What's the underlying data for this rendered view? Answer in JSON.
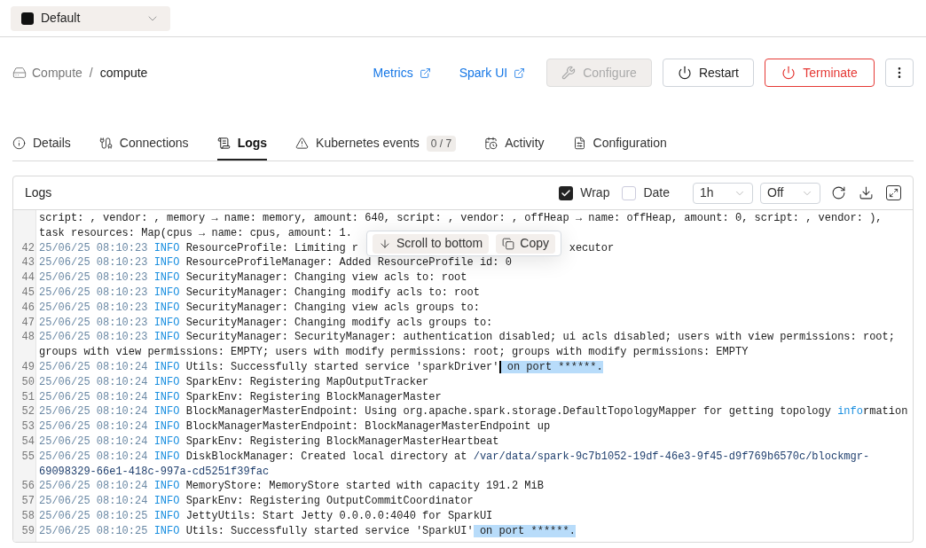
{
  "environment": {
    "label": "Default",
    "color": "#111111"
  },
  "breadcrumb_separator": "/",
  "breadcrumb": [
    {
      "label": "Compute",
      "kind": "parent"
    },
    {
      "label": "compute",
      "kind": "current"
    }
  ],
  "links": [
    {
      "label": "Metrics"
    },
    {
      "label": "Spark UI"
    }
  ],
  "actions": [
    {
      "label": "Configure",
      "kind": "configure",
      "disabled": true
    },
    {
      "label": "Restart",
      "kind": "restart",
      "disabled": false
    },
    {
      "label": "Terminate",
      "kind": "terminate",
      "disabled": false
    }
  ],
  "tabs": [
    {
      "label": "Details",
      "kind": "details",
      "selected": false
    },
    {
      "label": "Connections",
      "kind": "connections",
      "selected": false
    },
    {
      "label": "Logs",
      "kind": "logs",
      "selected": true
    },
    {
      "label": "Kubernetes events",
      "kind": "events",
      "badge": "0 / 7",
      "selected": false
    },
    {
      "label": "Activity",
      "kind": "activity",
      "selected": false
    },
    {
      "label": "Configuration",
      "kind": "configuration",
      "selected": false
    }
  ],
  "logs": {
    "title": "Logs",
    "options": [
      {
        "label": "Wrap",
        "checked": true
      },
      {
        "label": "Date",
        "checked": false
      }
    ],
    "selects": [
      {
        "value": "1h"
      },
      {
        "value": "Off"
      }
    ],
    "popup": [
      {
        "label": "Scroll to bottom",
        "kind": "scroll"
      },
      {
        "label": "Copy",
        "kind": "copy"
      }
    ],
    "lines": [
      {
        "segments": [
          {
            "kind": "plain",
            "text": "script: , vendor: , memory → name: memory, amount: 640, script: , vendor: , offHeap → name: offHeap, amount: 0, script: , vendor: ), task resources: Map(cpus → name: cpus, amount: 1."
          }
        ]
      },
      {
        "number": "42",
        "time": "25/06/25 08:10:23",
        "level": "INFO",
        "segments": [
          {
            "kind": "plain",
            "text": "ResourceProfile: Limiting r"
          },
          {
            "kind": "covered"
          },
          {
            "kind": "plain",
            "text": "xecutor"
          }
        ]
      },
      {
        "number": "43",
        "time": "25/06/25 08:10:23",
        "level": "INFO",
        "segments": [
          {
            "kind": "plain",
            "text": "ResourceProfileManager: Added ResourceProfile id: 0"
          }
        ]
      },
      {
        "number": "44",
        "time": "25/06/25 08:10:23",
        "level": "INFO",
        "segments": [
          {
            "kind": "plain",
            "text": "SecurityManager: Changing view acls to: root"
          }
        ]
      },
      {
        "number": "45",
        "time": "25/06/25 08:10:23",
        "level": "INFO",
        "segments": [
          {
            "kind": "plain",
            "text": "SecurityManager: Changing modify acls to: root"
          }
        ]
      },
      {
        "number": "46",
        "time": "25/06/25 08:10:23",
        "level": "INFO",
        "segments": [
          {
            "kind": "plain",
            "text": "SecurityManager: Changing view acls groups to:"
          }
        ]
      },
      {
        "number": "47",
        "time": "25/06/25 08:10:23",
        "level": "INFO",
        "segments": [
          {
            "kind": "plain",
            "text": "SecurityManager: Changing modify acls groups to:"
          }
        ]
      },
      {
        "number": "48",
        "time": "25/06/25 08:10:23",
        "level": "INFO",
        "segments": [
          {
            "kind": "plain",
            "text": "SecurityManager: SecurityManager: authentication disabled; ui acls disabled; users with view permissions: root; groups with view permissions: EMPTY; users with modify permissions: root; groups with modify permissions: EMPTY"
          }
        ]
      },
      {
        "number": "49",
        "time": "25/06/25 08:10:24",
        "level": "INFO",
        "segments": [
          {
            "kind": "plain",
            "text": "Utils: Successfully started service 'sparkDriver'"
          },
          {
            "kind": "selected",
            "caret": true,
            "text": " on port ******."
          }
        ]
      },
      {
        "number": "50",
        "time": "25/06/25 08:10:24",
        "level": "INFO",
        "segments": [
          {
            "kind": "plain",
            "text": "SparkEnv: Registering MapOutputTracker"
          }
        ]
      },
      {
        "number": "51",
        "time": "25/06/25 08:10:24",
        "level": "INFO",
        "segments": [
          {
            "kind": "plain",
            "text": "SparkEnv: Registering BlockManagerMaster"
          }
        ]
      },
      {
        "number": "52",
        "time": "25/06/25 08:10:24",
        "level": "INFO",
        "segments": [
          {
            "kind": "plain",
            "text": "BlockManagerMasterEndpoint: Using org.apache.spark.storage.DefaultTopologyMapper for getting topology "
          },
          {
            "kind": "match",
            "text": "info"
          },
          {
            "kind": "plain",
            "text": "rmation"
          }
        ]
      },
      {
        "number": "53",
        "time": "25/06/25 08:10:24",
        "level": "INFO",
        "segments": [
          {
            "kind": "plain",
            "text": "BlockManagerMasterEndpoint: BlockManagerMasterEndpoint up"
          }
        ]
      },
      {
        "number": "54",
        "time": "25/06/25 08:10:24",
        "level": "INFO",
        "segments": [
          {
            "kind": "plain",
            "text": "SparkEnv: Registering BlockManagerMasterHeartbeat"
          }
        ]
      },
      {
        "number": "55",
        "time": "25/06/25 08:10:24",
        "level": "INFO",
        "segments": [
          {
            "kind": "plain",
            "text": "DiskBlockManager: Created local directory at "
          },
          {
            "kind": "path",
            "text": "/var/data/spark-9c7b1052-19df-46e3-9f45-d9f769b6570c/blockmgr-69098329-66e1-418c-997a-cd5251f39fac"
          }
        ]
      },
      {
        "number": "56",
        "time": "25/06/25 08:10:24",
        "level": "INFO",
        "segments": [
          {
            "kind": "plain",
            "text": "MemoryStore: MemoryStore started with capacity 191.2 MiB"
          }
        ]
      },
      {
        "number": "57",
        "time": "25/06/25 08:10:24",
        "level": "INFO",
        "segments": [
          {
            "kind": "plain",
            "text": "SparkEnv: Registering OutputCommitCoordinator"
          }
        ]
      },
      {
        "number": "58",
        "time": "25/06/25 08:10:25",
        "level": "INFO",
        "segments": [
          {
            "kind": "plain",
            "text": "JettyUtils: Start Jetty 0.0.0.0:4040 for SparkUI"
          }
        ]
      },
      {
        "number": "59",
        "time": "25/06/25 08:10:25",
        "level": "INFO",
        "segments": [
          {
            "kind": "plain",
            "text": "Utils: Successfully started service 'SparkUI'"
          },
          {
            "kind": "selected",
            "caret": false,
            "text": " on port ******."
          }
        ]
      }
    ]
  }
}
